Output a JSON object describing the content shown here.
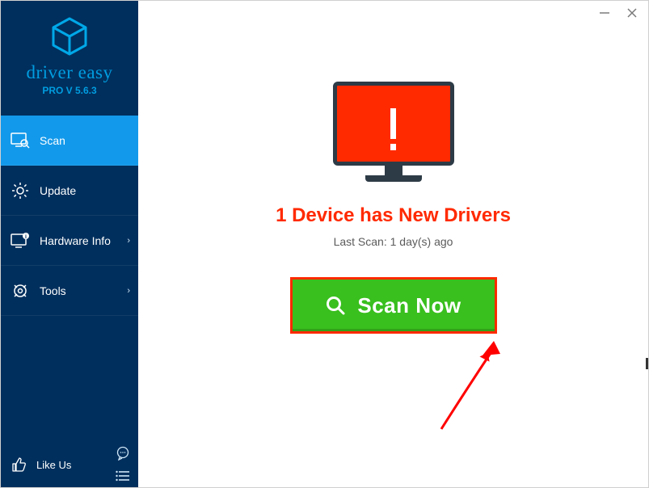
{
  "brand": {
    "name": "driver easy",
    "version": "PRO V 5.6.3"
  },
  "sidebar": {
    "items": [
      {
        "label": "Scan",
        "has_chevron": false,
        "active": true
      },
      {
        "label": "Update",
        "has_chevron": false,
        "active": false
      },
      {
        "label": "Hardware Info",
        "has_chevron": true,
        "active": false
      },
      {
        "label": "Tools",
        "has_chevron": true,
        "active": false
      }
    ],
    "like_us": "Like Us"
  },
  "main": {
    "headline": "1 Device has New Drivers",
    "last_scan": "Last Scan: 1 day(s) ago",
    "scan_button": "Scan Now"
  }
}
